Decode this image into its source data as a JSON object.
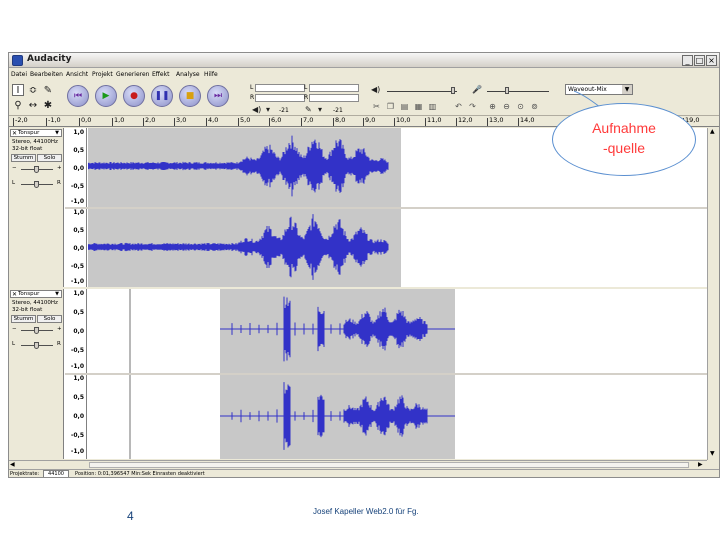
{
  "window": {
    "title": "Audacity",
    "buttons": [
      "_",
      "□",
      "×"
    ]
  },
  "menu": [
    "Datei",
    "Bearbeiten",
    "Ansicht",
    "Projekt",
    "Generieren",
    "Effekt",
    "Analyse",
    "Hilfe"
  ],
  "meters": {
    "left": "L",
    "right": "R",
    "db1": "-21",
    "db2": "-21"
  },
  "input_source": {
    "selected": "Waveout-Mix"
  },
  "ruler": {
    "ticks": [
      "-2,0",
      "-1,0",
      "0,0",
      "1,0",
      "2,0",
      "3,0",
      "4,0",
      "5,0",
      "6,0",
      "7,0",
      "8,0",
      "9,0",
      "10,0",
      "11,0",
      "12,0",
      "13,0",
      "14,0",
      "19,0"
    ]
  },
  "tracks": [
    {
      "name": "Tonspur",
      "info1": "Stereo, 44100Hz",
      "info2": "32-bit float",
      "mute": "Stumm",
      "solo": "Solo",
      "gain_minus": "−",
      "gain_plus": "+",
      "pan_left": "L",
      "pan_right": "R",
      "scale": [
        "1,0",
        "0,5",
        "0,0",
        "-0,5",
        "-1,0"
      ]
    },
    {
      "name": "Tonspur",
      "info1": "Stereo, 44100Hz",
      "info2": "32-bit float",
      "mute": "Stumm",
      "solo": "Solo",
      "gain_minus": "−",
      "gain_plus": "+",
      "pan_left": "L",
      "pan_right": "R",
      "scale": [
        "1,0",
        "0,5",
        "0,0",
        "-0,5",
        "-1,0"
      ]
    }
  ],
  "status": {
    "rate_label": "Projektrate:",
    "rate_value": "44100",
    "position": "Position: 0:01,396547 Min:Sek   Einrasten deaktiviert"
  },
  "callout": {
    "line1": "Aufnahme",
    "line2": "-quelle"
  },
  "footer": {
    "page": "4",
    "credit": "Josef Kapeller Web2.0 für Fg."
  },
  "colors": {
    "waveform": "#3232c8",
    "selection": "#c8c8c8",
    "callout_text": "#ff3a3a",
    "footer_text": "#16427a"
  }
}
